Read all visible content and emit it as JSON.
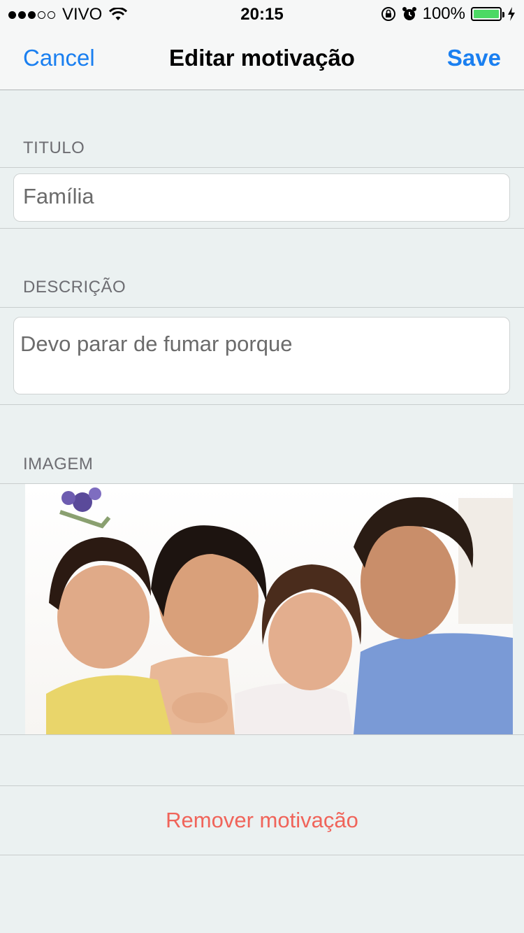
{
  "status_bar": {
    "carrier": "VIVO",
    "time": "20:15",
    "battery": "100%",
    "battery_level": 1.0,
    "signal_bars": 3,
    "signal_max": 5,
    "icons": [
      "signal-icon",
      "wifi-icon",
      "orientation-lock-icon",
      "alarm-icon",
      "battery-icon",
      "charging-icon"
    ]
  },
  "nav": {
    "cancel": "Cancel",
    "title": "Editar motivação",
    "save": "Save"
  },
  "form": {
    "title_header": "TITULO",
    "title_value": "Família",
    "description_header": "DESCRIÇÃO",
    "description_value": "Devo parar de fumar porque",
    "image_header": "IMAGEM"
  },
  "actions": {
    "remove": "Remover motivação"
  },
  "colors": {
    "accent": "#1a7ff0",
    "destructive": "#f0645a",
    "battery": "#4cd964",
    "background": "#ebf1f1"
  }
}
